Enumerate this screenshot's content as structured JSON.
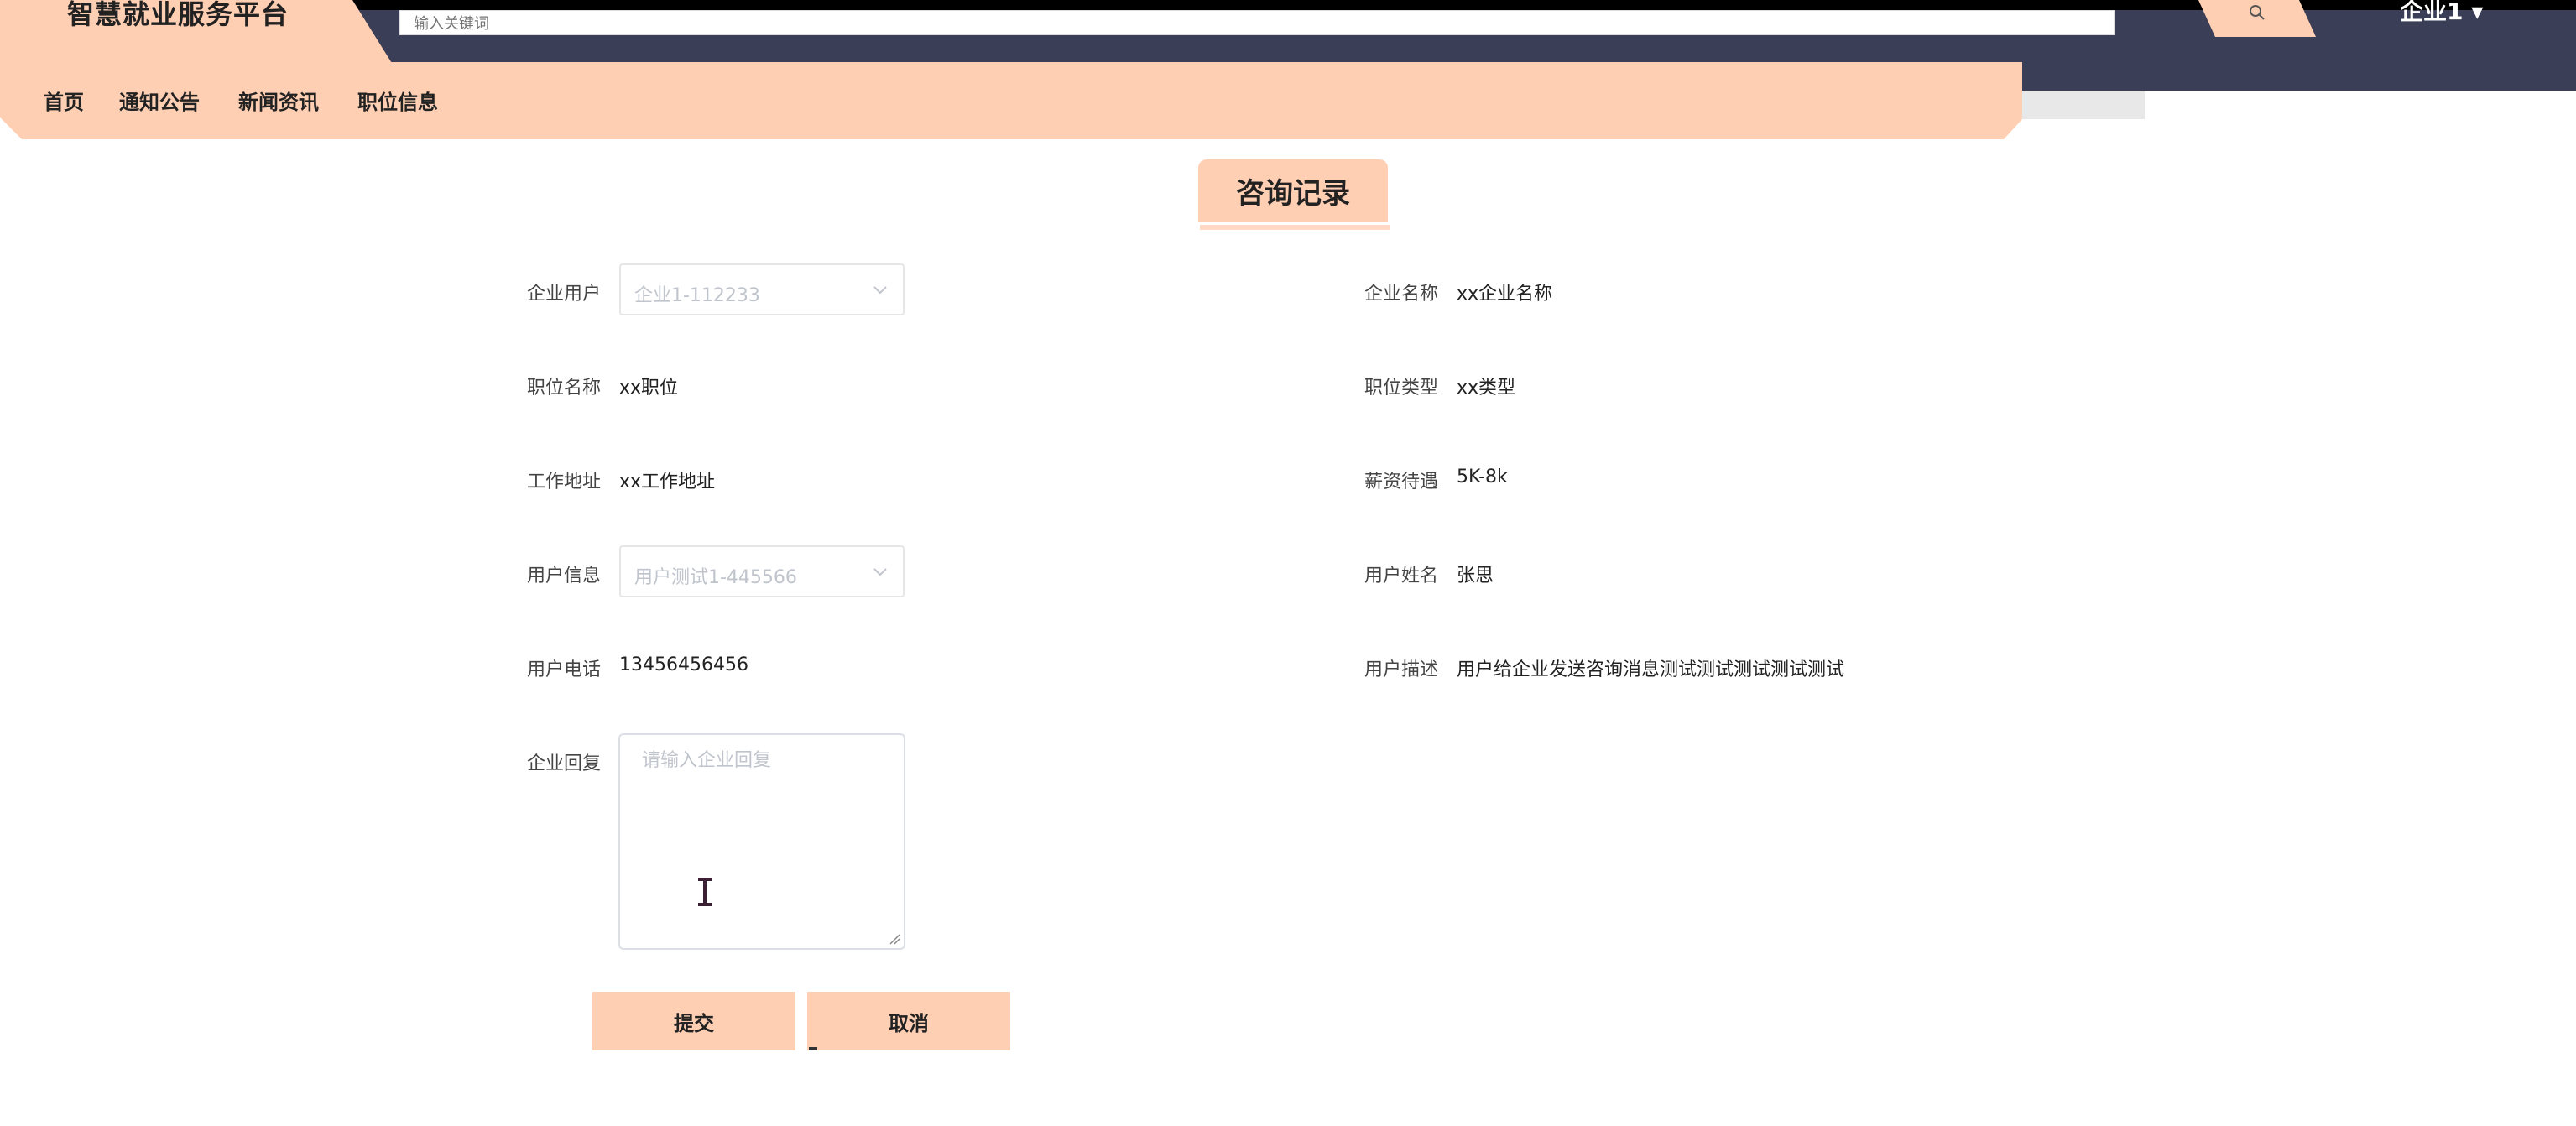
{
  "header": {
    "site_title": "智慧就业服务平台",
    "search_placeholder": "输入关键词",
    "user_menu_label": "企业1 ▾"
  },
  "nav": {
    "items": [
      {
        "label": "首页"
      },
      {
        "label": "通知公告"
      },
      {
        "label": "新闻资讯"
      },
      {
        "label": "职位信息"
      }
    ]
  },
  "section": {
    "title": "咨询记录"
  },
  "form": {
    "company_user": {
      "label": "企业用户",
      "value": "企业1-112233"
    },
    "company_name": {
      "label": "企业名称",
      "value": "xx企业名称"
    },
    "job_title": {
      "label": "职位名称",
      "value": "xx职位"
    },
    "job_type": {
      "label": "职位类型",
      "value": "xx类型"
    },
    "work_address": {
      "label": "工作地址",
      "value": "xx工作地址"
    },
    "salary": {
      "label": "薪资待遇",
      "value": "5K-8k"
    },
    "user_info": {
      "label": "用户信息",
      "value": "用户测试1-445566"
    },
    "user_name": {
      "label": "用户姓名",
      "value": "张思"
    },
    "user_phone": {
      "label": "用户电话",
      "value": "13456456456"
    },
    "user_desc": {
      "label": "用户描述",
      "value": "用户给企业发送咨询消息测试测试测试测试测试"
    },
    "company_reply": {
      "label": "企业回复",
      "placeholder": "请输入企业回复"
    }
  },
  "actions": {
    "submit_label": "提交",
    "cancel_label": "取消"
  },
  "colors": {
    "accent": "#ffcfb3",
    "header_dark": "#3a3f57"
  }
}
